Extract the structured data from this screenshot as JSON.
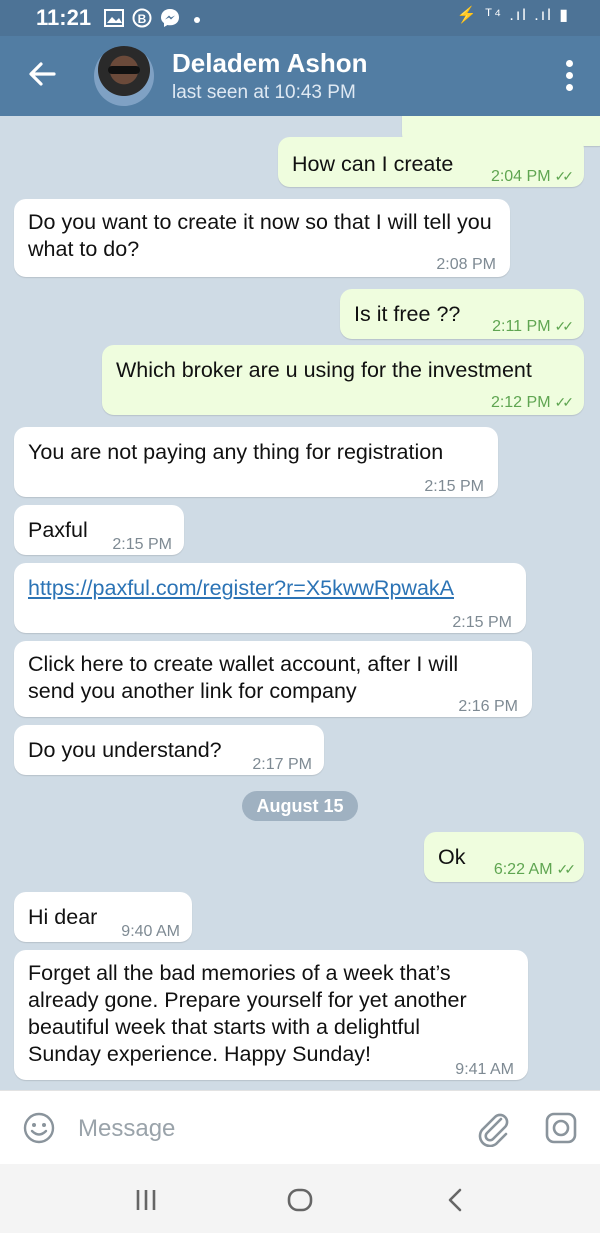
{
  "status_bar": {
    "time": "11:21",
    "right_icons": "⚡ ᵀ⁴ .ıl .ıl ▮"
  },
  "header": {
    "contact_name": "Deladem Ashon",
    "last_seen": "last seen at 10:43 PM"
  },
  "messages": [
    {
      "dir": "out",
      "text": "How can I create",
      "time": "2:04 PM",
      "read": true
    },
    {
      "dir": "in",
      "text": "Do you want to create it now so that I will tell you what to do?",
      "time": "2:08 PM"
    },
    {
      "dir": "out",
      "text": "Is it free ??",
      "time": "2:11 PM",
      "read": true
    },
    {
      "dir": "out",
      "text": "Which broker are u using for the investment",
      "time": "2:12 PM",
      "read": true
    },
    {
      "dir": "in",
      "text": "You are not paying any thing for registration",
      "time": "2:15 PM"
    },
    {
      "dir": "in",
      "text": "Paxful",
      "time": "2:15 PM"
    },
    {
      "dir": "in",
      "text": "https://paxful.com/register?r=X5kwwRpwakA",
      "time": "2:15 PM",
      "link": true
    },
    {
      "dir": "in",
      "text": "Click here to create wallet account, after I will send you another link for company",
      "time": "2:16 PM"
    },
    {
      "dir": "in",
      "text": "Do you understand?",
      "time": "2:17 PM"
    },
    {
      "dir": "out",
      "text": "Ok",
      "time": "6:22 AM",
      "read": true
    },
    {
      "dir": "in",
      "text": "Hi dear",
      "time": "9:40 AM"
    },
    {
      "dir": "in",
      "text": "Forget all the bad memories of a week that’s already gone. Prepare yourself for yet another beautiful week that starts with a delightful Sunday experience. Happy Sunday!",
      "time": "9:41 AM"
    }
  ],
  "date_separator": "August 15",
  "input": {
    "placeholder": "Message"
  },
  "colors": {
    "header": "#527da3",
    "incoming": "#ffffff",
    "outgoing": "#effdde",
    "link": "#2b73b5",
    "chat_bg": "#cfdbe5"
  }
}
